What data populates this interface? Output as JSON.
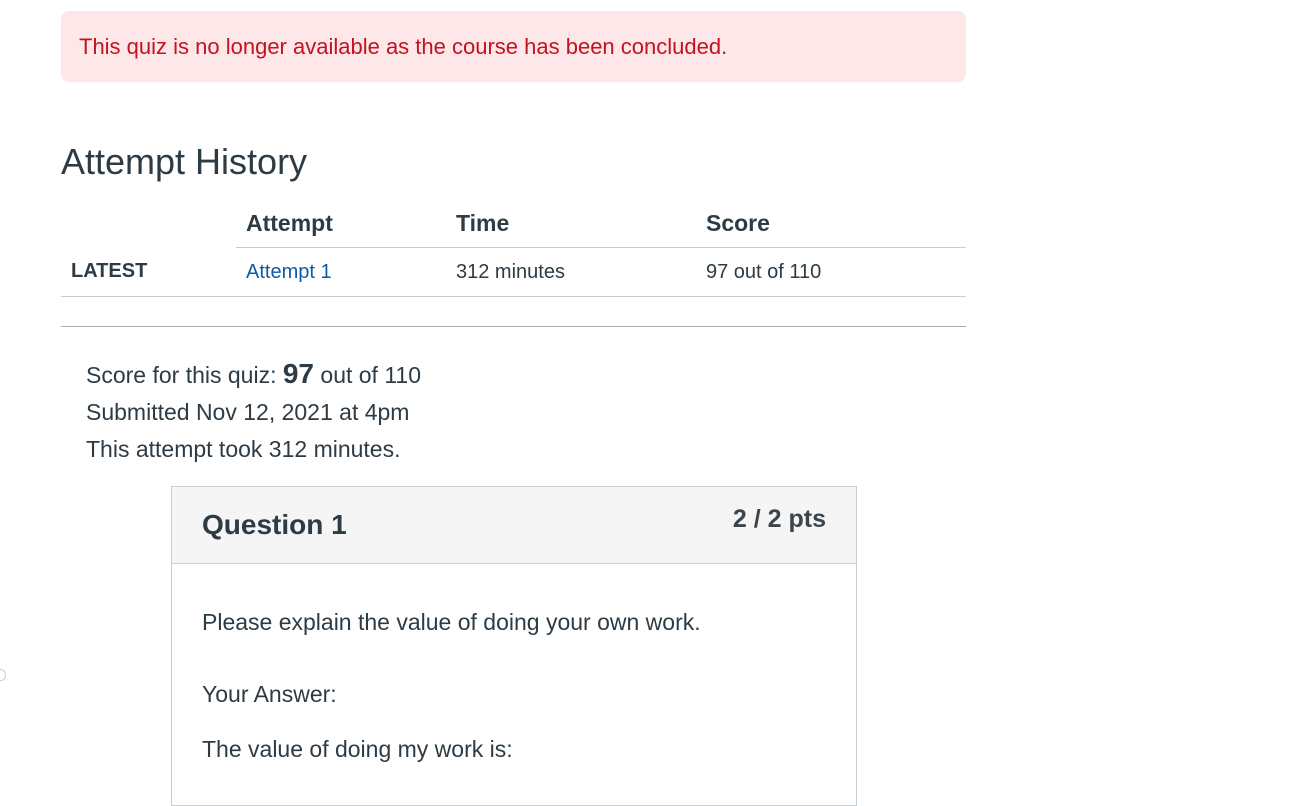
{
  "alert": {
    "message": "This quiz is no longer available as the course has been concluded."
  },
  "attempt_history": {
    "title": "Attempt History",
    "columns": [
      "",
      "Attempt",
      "Time",
      "Score"
    ],
    "rows": [
      {
        "badge": "LATEST",
        "attempt": "Attempt 1",
        "time": "312 minutes",
        "score": "97 out of 110"
      }
    ]
  },
  "summary": {
    "score_label": "Score for this quiz:",
    "score_value": "97",
    "score_suffix": "out of 110",
    "submitted": "Submitted Nov 12, 2021 at 4pm",
    "duration": "This attempt took 312 minutes."
  },
  "question": {
    "name": "Question 1",
    "points": "2 / 2 pts",
    "text": "Please explain the value of doing your own work.",
    "your_answer_label": "Your Answer:",
    "answer": "The value of doing my work is:"
  },
  "colors": {
    "alert_bg": "#fde7e9",
    "alert_text": "#c4121e",
    "link": "#0b5ca8",
    "text": "#2d3b45"
  }
}
